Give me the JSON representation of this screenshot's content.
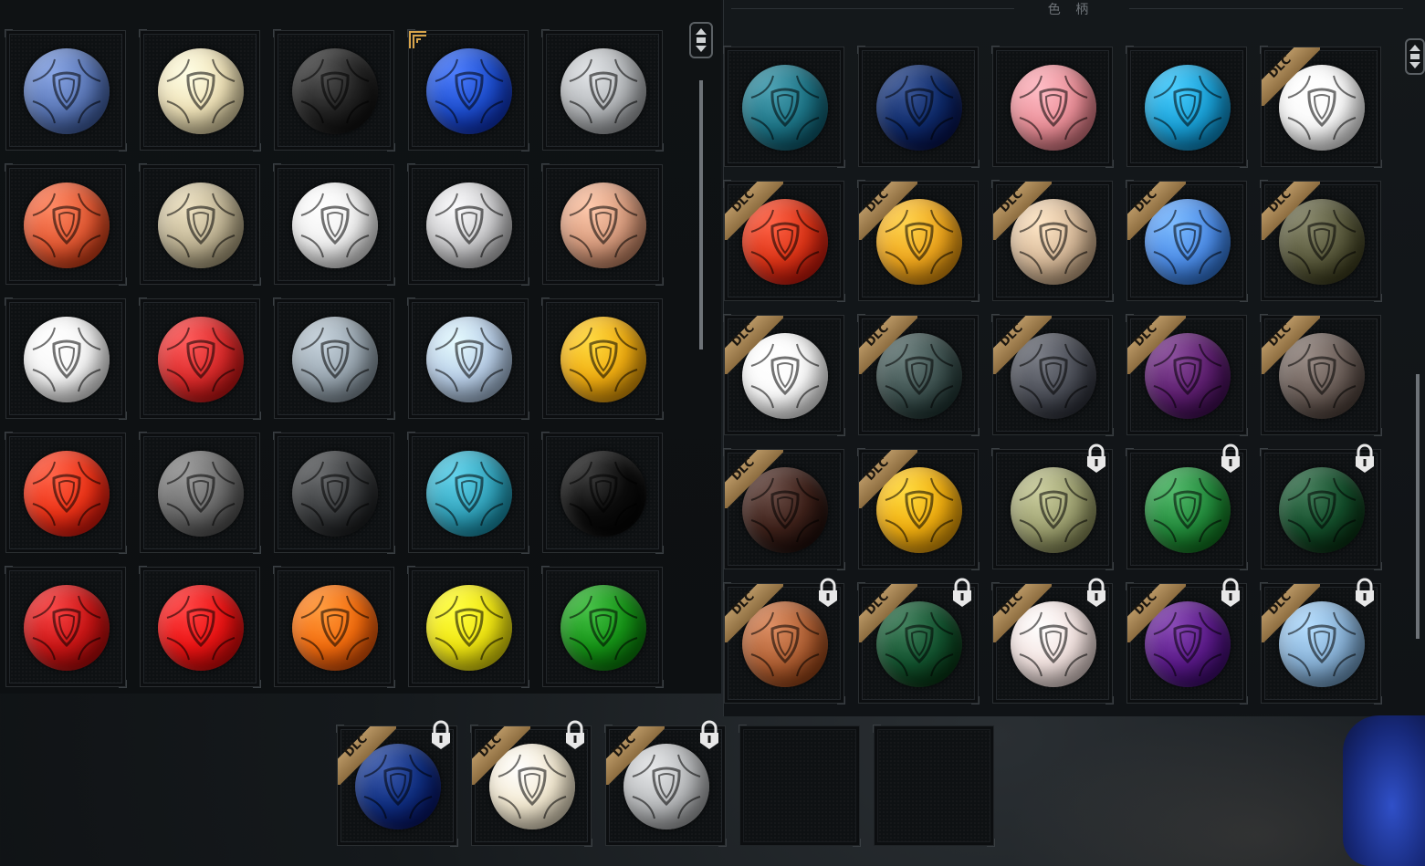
{
  "panel_title": "色 柄",
  "colors": {
    "tile_border": "#2a2e31",
    "dlc_gold": "#a4834f",
    "lock": "#e8e8e8"
  },
  "left_grid": {
    "columns": 5,
    "items": [
      {
        "color": "#5b78b8",
        "state": "normal"
      },
      {
        "color": "#efe2b8",
        "state": "normal"
      },
      {
        "color": "#242424",
        "state": "normal"
      },
      {
        "color": "#1e4fd0",
        "state": "selected"
      },
      {
        "color": "#b5b8bb",
        "state": "normal"
      },
      {
        "color": "#e45a34",
        "state": "normal"
      },
      {
        "color": "#c1b595",
        "state": "normal"
      },
      {
        "color": "#f1f1f1",
        "state": "normal"
      },
      {
        "color": "#cfcfd1",
        "state": "normal"
      },
      {
        "color": "#d89c7e",
        "state": "normal"
      },
      {
        "color": "#f6f6f6",
        "state": "normal"
      },
      {
        "color": "#dc2c2c",
        "state": "normal"
      },
      {
        "color": "#9aa7b1",
        "state": "normal"
      },
      {
        "color": "#b9cfe8",
        "state": "normal"
      },
      {
        "color": "#f0ad11",
        "state": "normal"
      },
      {
        "color": "#ee3418",
        "state": "normal"
      },
      {
        "color": "#6d6d6d",
        "state": "normal"
      },
      {
        "color": "#3a3c3e",
        "state": "normal"
      },
      {
        "color": "#34a6bf",
        "state": "normal"
      },
      {
        "color": "#0b0b0b",
        "state": "normal"
      },
      {
        "color": "#cc1616",
        "state": "normal"
      },
      {
        "color": "#ec1414",
        "state": "normal"
      },
      {
        "color": "#f46d0e",
        "state": "normal"
      },
      {
        "color": "#f0e612",
        "state": "normal"
      },
      {
        "color": "#169417",
        "state": "normal"
      }
    ]
  },
  "right_grid": {
    "columns": 5,
    "items": [
      {
        "color": "#1d7486",
        "dlc": false,
        "locked": false
      },
      {
        "color": "#0e2a6a",
        "dlc": false,
        "locked": false
      },
      {
        "color": "#ea8f98",
        "dlc": false,
        "locked": false
      },
      {
        "color": "#1aa0d6",
        "dlc": false,
        "locked": false
      },
      {
        "color": "#fafafa",
        "dlc": true,
        "locked": false
      },
      {
        "color": "#dc3417",
        "dlc": true,
        "locked": false
      },
      {
        "color": "#eea61d",
        "dlc": true,
        "locked": false
      },
      {
        "color": "#d6b999",
        "dlc": true,
        "locked": false
      },
      {
        "color": "#4e8ee8",
        "dlc": true,
        "locked": false
      },
      {
        "color": "#58583b",
        "dlc": true,
        "locked": false
      },
      {
        "color": "#fbfbfb",
        "dlc": true,
        "locked": false
      },
      {
        "color": "#3d514f",
        "dlc": true,
        "locked": false
      },
      {
        "color": "#4b4e57",
        "dlc": true,
        "locked": false
      },
      {
        "color": "#5c1e6e",
        "dlc": true,
        "locked": false
      },
      {
        "color": "#6b5e58",
        "dlc": true,
        "locked": false
      },
      {
        "color": "#3d2019",
        "dlc": true,
        "locked": false
      },
      {
        "color": "#f0ae10",
        "dlc": true,
        "locked": false
      },
      {
        "color": "#9da070",
        "dlc": false,
        "locked": true
      },
      {
        "color": "#238b3c",
        "dlc": false,
        "locked": true
      },
      {
        "color": "#134d2a",
        "dlc": false,
        "locked": true
      },
      {
        "color": "#b06034",
        "dlc": true,
        "locked": true
      },
      {
        "color": "#12522e",
        "dlc": true,
        "locked": true
      },
      {
        "color": "#f3e3e0",
        "dlc": true,
        "locked": true
      },
      {
        "color": "#5a1a88",
        "dlc": true,
        "locked": true
      },
      {
        "color": "#88b1d6",
        "dlc": true,
        "locked": true
      }
    ]
  },
  "bottom_row": {
    "items": [
      {
        "color": "#0f2e80",
        "dlc": true,
        "locked": true
      },
      {
        "color": "#f4ead2",
        "dlc": true,
        "locked": true
      },
      {
        "color": "#b9bbbd",
        "dlc": true,
        "locked": true
      },
      {
        "empty": true
      },
      {
        "empty": true
      }
    ]
  },
  "badges": {
    "dlc_label": "DLC"
  }
}
